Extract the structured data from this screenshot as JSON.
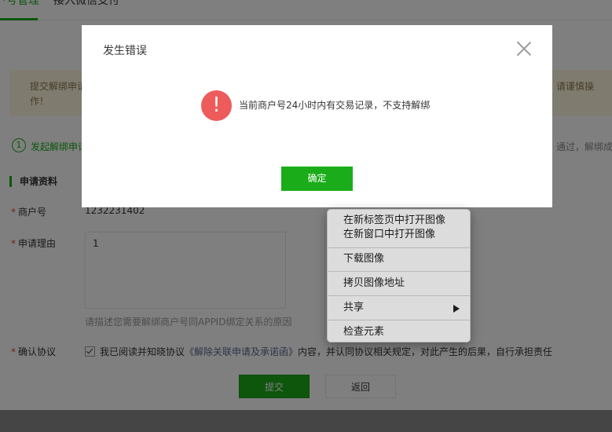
{
  "tabs": [
    {
      "label": "户号管理",
      "active": true
    },
    {
      "label": "接入微信支付",
      "active": false
    }
  ],
  "notice": {
    "left_text": "提交解绑申请作！",
    "right_text": "请谨慎操"
  },
  "steps": {
    "step_number": "1",
    "step_label": "发起解绑申请",
    "right_text": "通过，解绑成"
  },
  "form": {
    "section_title": "申请资料",
    "merchant_label": "商户号",
    "merchant_value": "1232231402",
    "reason_label": "申请理由",
    "reason_value": "1",
    "reason_hint": "请描述您需要解绑商户号同APPID绑定关系的原因",
    "agreement_label": "确认协议",
    "agreement_prefix": "我已阅读并知晓协议",
    "agreement_link": "《解除关联申请及承诺函》",
    "agreement_suffix": "内容，并认同协议相关规定，对此产生的后果，自行承担责任",
    "submit_label": "提交",
    "back_label": "返回",
    "required_mark": "*"
  },
  "dialog": {
    "title": "发生错误",
    "icon_glyph": "!",
    "message": "当前商户号24小时内有交易记录，不支持解绑",
    "ok_label": "确定"
  },
  "context_menu": {
    "items": [
      "在新标签页中打开图像",
      "在新窗口中打开图像",
      "下载图像",
      "拷贝图像地址",
      "共享",
      "检查元素"
    ]
  },
  "colors": {
    "accent": "#1aad19",
    "error": "#ed5b5b",
    "link": "#576b95",
    "notice_bg": "#fff7df"
  },
  "icons": {
    "close": "close-icon",
    "error": "error-icon",
    "submenu": "chevron-right-icon",
    "checkbox": "checkbox-checked-icon"
  }
}
